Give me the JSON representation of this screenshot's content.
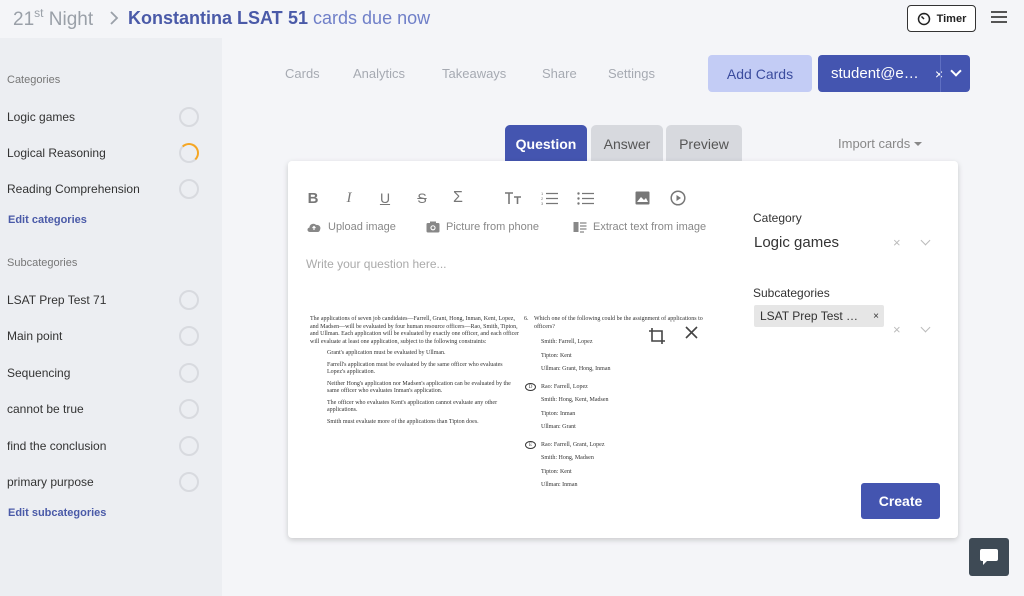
{
  "header": {
    "brand_main": "21",
    "brand_sup": "st",
    "brand_tail": " Night",
    "deck_title": "Konstantina LSAT",
    "due_count": "51",
    "due_text": " cards due now",
    "timer_label": "Timer"
  },
  "sidebar": {
    "categories_heading": "Categories",
    "categories": [
      {
        "label": "Logic games",
        "progress": "empty"
      },
      {
        "label": "Logical Reasoning",
        "progress": "partial"
      },
      {
        "label": "Reading Comprehension",
        "progress": "empty"
      }
    ],
    "edit_categories": "Edit categories",
    "subcategories_heading": "Subcategories",
    "subcategories": [
      {
        "label": "LSAT Prep Test 71"
      },
      {
        "label": "Main point"
      },
      {
        "label": "Sequencing"
      },
      {
        "label": "cannot be true"
      },
      {
        "label": "find the conclusion"
      },
      {
        "label": "primary purpose"
      }
    ],
    "edit_subcategories": "Edit subcategories"
  },
  "nav": {
    "items": [
      "Cards",
      "Analytics",
      "Takeaways",
      "Share",
      "Settings"
    ],
    "add_cards": "Add Cards",
    "student": "student@e…",
    "student_clear": "×"
  },
  "tabs": [
    "Question",
    "Answer",
    "Preview"
  ],
  "import_cards": "Import cards",
  "editor": {
    "upload_image": "Upload image",
    "picture_from_phone": "Picture from phone",
    "extract_text": "Extract text from image",
    "placeholder": "Write your question here..."
  },
  "doc": {
    "left": [
      "The applications of seven job candidates—Farrell, Grant, Hong, Inman, Kent, Lopez, and Madsen—will be evaluated by four human resource officers—Rao, Smith, Tipton, and Ullman. Each application will be evaluated by exactly one officer, and each officer will evaluate at least one application, subject to the following constraints:",
      "Grant's application must be evaluated by Ullman.",
      "Farrell's application must be evaluated by the same officer who evaluates Lopez's application.",
      "Neither Hong's application nor Madsen's application can be evaluated by the same officer who evaluates Inman's application.",
      "The officer who evaluates Kent's application cannot evaluate any other applications.",
      "Smith must evaluate more of the applications than Tipton does."
    ],
    "q_number": "6.",
    "q_text": "Which one of the following could be the assignment of applications to officers?",
    "options": [
      {
        "letter": "",
        "lines": [
          "Smith: Farrell, Lopez",
          "Tipton: Kent",
          "Ullman: Grant, Hong, Inman"
        ]
      },
      {
        "letter": "D",
        "lines": [
          "Rao: Farrell, Lopez",
          "Smith: Hong, Kent, Madsen",
          "Tipton: Inman",
          "Ullman: Grant"
        ]
      },
      {
        "letter": "E",
        "lines": [
          "Rao: Farrell, Grant, Lopez",
          "Smith: Hong, Madsen",
          "Tipton: Kent",
          "Ullman: Inman"
        ]
      }
    ]
  },
  "side_panel": {
    "category_label": "Category",
    "category_value": "Logic games",
    "subcategories_label": "Subcategories",
    "chip": "LSAT Prep Test …",
    "chip_close": "×",
    "clear": "×"
  },
  "create": "Create",
  "colors": {
    "primary": "#4455b0",
    "accent_light": "#c3ccf5",
    "progress": "#f5a623"
  }
}
